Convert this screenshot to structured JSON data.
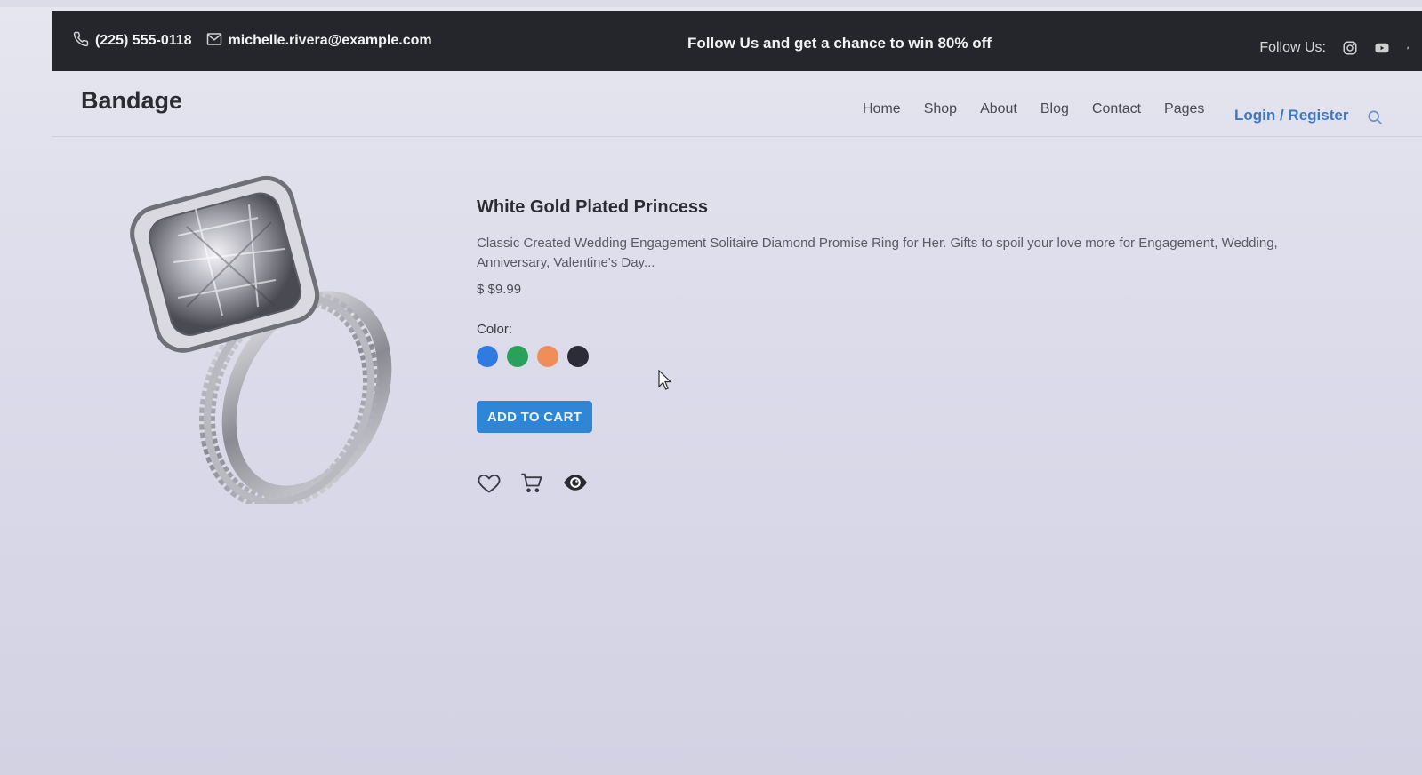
{
  "topbar": {
    "phone": "(225) 555-0118",
    "email": "michelle.rivera@example.com",
    "promo": "Follow Us and get a chance to win 80% off",
    "follow_label": "Follow Us:",
    "social_icons": [
      "instagram-icon",
      "youtube-icon",
      "facebook-icon"
    ]
  },
  "header": {
    "brand": "Bandage",
    "nav": [
      "Home",
      "Shop",
      "About",
      "Blog",
      "Contact",
      "Pages"
    ],
    "login": "Login / Register"
  },
  "product": {
    "title": "White Gold Plated Princess",
    "description": "Classic Created Wedding Engagement Solitaire Diamond Promise Ring for Her. Gifts to spoil your love more for Engagement, Wedding, Anniversary, Valentine's Day...",
    "price": "$ $9.99",
    "color_label": "Color:",
    "colors": [
      "#2f7be0",
      "#2aa15a",
      "#f08e5a",
      "#2b2c37"
    ],
    "add_to_cart": "ADD TO CART"
  },
  "colors": {
    "topbar_bg": "#24262b",
    "accent": "#2f86d6",
    "link": "#3d79c4"
  }
}
